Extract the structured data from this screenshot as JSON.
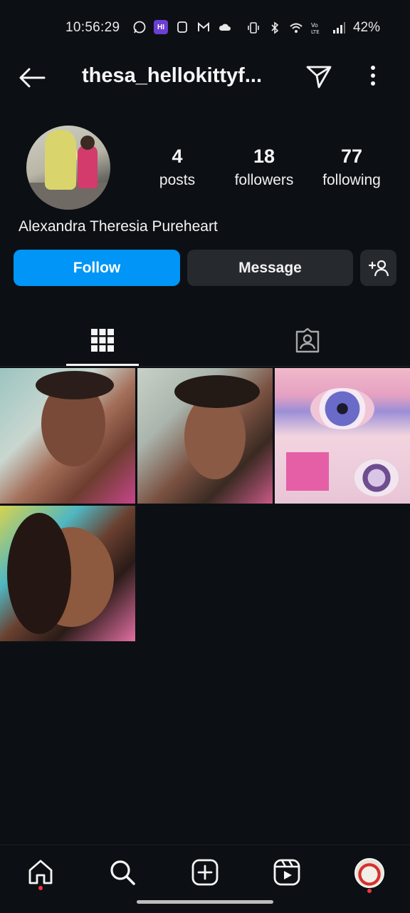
{
  "status_bar": {
    "time": "10:56:29",
    "battery": "42%",
    "icons": [
      "whatsapp-icon",
      "app-badge-icon",
      "bookmark-app-icon",
      "gmail-icon",
      "cloud-icon",
      "vibrate-icon",
      "bluetooth-icon",
      "wifi-icon",
      "volte-icon",
      "signal-icon"
    ],
    "badge_text": "HI"
  },
  "header": {
    "username": "thesa_hellokittyf...",
    "back_icon": "arrow-left-icon",
    "send_icon": "paper-plane-icon",
    "more_icon": "more-vertical-icon"
  },
  "profile": {
    "full_name": "Alexandra Theresia Pureheart",
    "stats": {
      "posts": {
        "value": "4",
        "label": "posts"
      },
      "followers": {
        "value": "18",
        "label": "followers"
      },
      "following": {
        "value": "77",
        "label": "following"
      }
    }
  },
  "actions": {
    "follow_label": "Follow",
    "message_label": "Message",
    "suggest_icon": "add-person-icon"
  },
  "tabs": [
    {
      "name": "grid",
      "icon": "grid-icon",
      "active": true
    },
    {
      "name": "tagged",
      "icon": "tagged-person-icon",
      "active": false
    }
  ],
  "posts": [
    {
      "name": "post-1"
    },
    {
      "name": "post-2"
    },
    {
      "name": "post-3"
    },
    {
      "name": "post-4"
    }
  ],
  "bottom_nav": {
    "items": [
      "home-icon",
      "search-icon",
      "create-post-icon",
      "reels-icon",
      "profile-avatar-icon"
    ]
  },
  "colors": {
    "background": "#0c1014",
    "follow_button": "#0095f6",
    "secondary_button": "#262a2f",
    "notification_dot": "#ff3040"
  }
}
